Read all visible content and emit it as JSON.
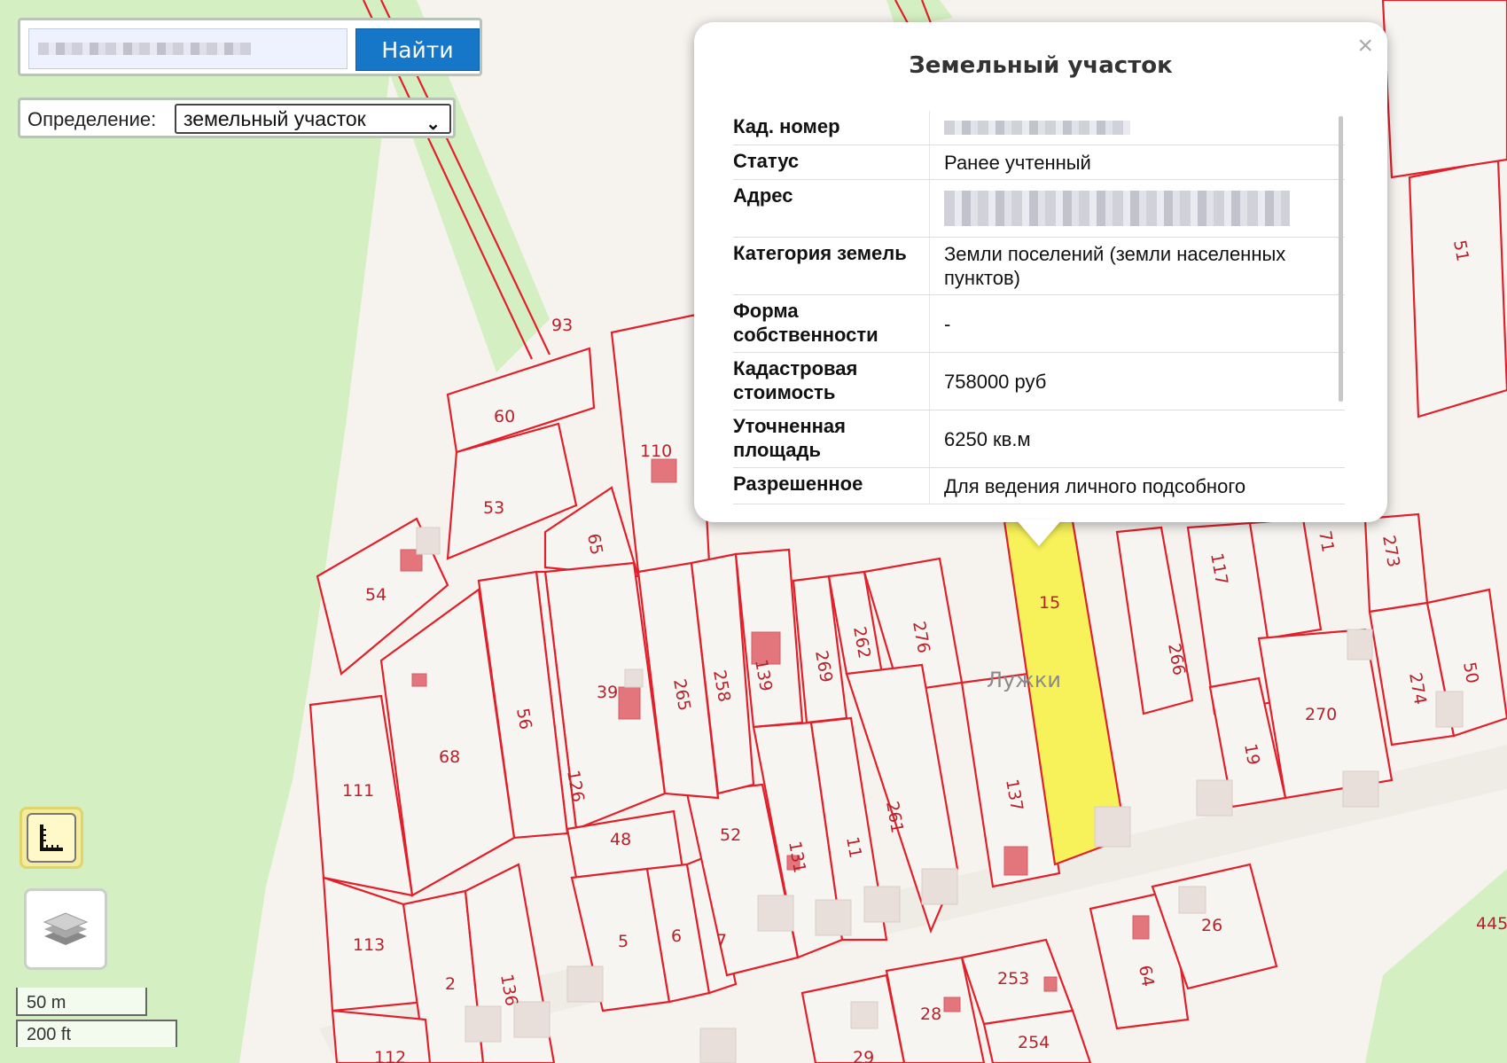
{
  "search": {
    "button_label": "Найти"
  },
  "define": {
    "label": "Определение:",
    "selected": "земельный участок"
  },
  "popup": {
    "title": "Земельный участок",
    "close": "×",
    "rows": [
      {
        "key": "Кад. номер",
        "value": ""
      },
      {
        "key": "Статус",
        "value": "Ранее учтенный"
      },
      {
        "key": "Адрес",
        "value": ""
      },
      {
        "key": "Категория земель",
        "value": "Земли поселений (земли населенных пунктов)"
      },
      {
        "key": "Форма собственности",
        "value": "-"
      },
      {
        "key": "Кадастровая стоимость",
        "value": "758000 руб"
      },
      {
        "key": "Уточненная площадь",
        "value": "6250 кв.м"
      },
      {
        "key": "Разрешенное",
        "value": "Для ведения личного подсобного"
      }
    ]
  },
  "scale": {
    "metric": "50 m",
    "imperial": "200 ft"
  },
  "map": {
    "place_name": "Лужки",
    "selected_plot": "15",
    "plot_labels": [
      "93",
      "60",
      "53",
      "54",
      "65",
      "110",
      "39",
      "126",
      "56",
      "68",
      "111",
      "113",
      "2",
      "136",
      "112",
      "48",
      "5",
      "6",
      "7",
      "52",
      "131",
      "11",
      "261",
      "139",
      "265",
      "258",
      "269",
      "262",
      "276",
      "137",
      "266",
      "117",
      "71",
      "273",
      "51",
      "274",
      "50",
      "270",
      "19",
      "64",
      "26",
      "253",
      "28",
      "254",
      "29",
      "445"
    ]
  },
  "colors": {
    "plot_border": "#e0202a",
    "selected_fill": "#f8f25a",
    "green_area": "#d4f0c2",
    "button": "#1677c9"
  }
}
